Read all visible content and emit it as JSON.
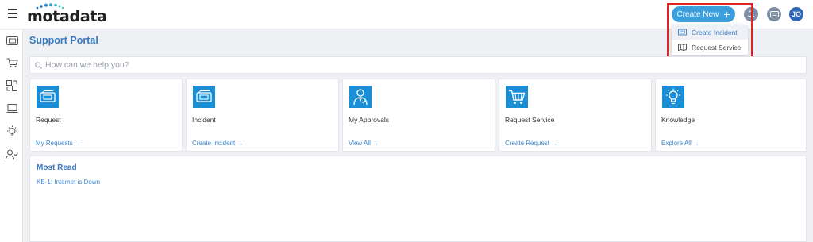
{
  "header": {
    "logo_text": "motadata",
    "create_new_label": "Create New",
    "create_new_plus": "+",
    "avatar_initials": "JO",
    "icons": [
      "hamburger-icon",
      "bell-icon",
      "keyboard-icon"
    ]
  },
  "dropdown": {
    "items": [
      {
        "label": "Create Incident",
        "icon": "incident-icon",
        "active": true
      },
      {
        "label": "Request Service",
        "icon": "map-icon",
        "active": false
      }
    ],
    "highlight_color": "#e02424"
  },
  "sidebar": {
    "items": [
      "ticket-icon",
      "cart-icon",
      "approvals-icon",
      "laptop-icon",
      "lightbulb-icon",
      "user-check-icon"
    ]
  },
  "main": {
    "page_title": "Support Portal",
    "search_placeholder": "How can we help you?",
    "cards": [
      {
        "title": "Request",
        "link": "My Requests →",
        "icon": "ticket-icon"
      },
      {
        "title": "Incident",
        "link": "Create Incident →",
        "icon": "ticket-icon"
      },
      {
        "title": "My Approvals",
        "link": "View All →",
        "icon": "approver-icon"
      },
      {
        "title": "Request Service",
        "link": "Create Request →",
        "icon": "cart-icon"
      },
      {
        "title": "Knowledge",
        "link": "Explore All →",
        "icon": "lightbulb-icon"
      }
    ],
    "most_read": {
      "title": "Most Read",
      "items": [
        "KB-1: Internet is Down"
      ]
    }
  },
  "colors": {
    "accent": "#3a9fdc",
    "link": "#3a86cf",
    "card_icon_bg": "#1a8fd6",
    "avatar_bg": "#2f65b5"
  }
}
